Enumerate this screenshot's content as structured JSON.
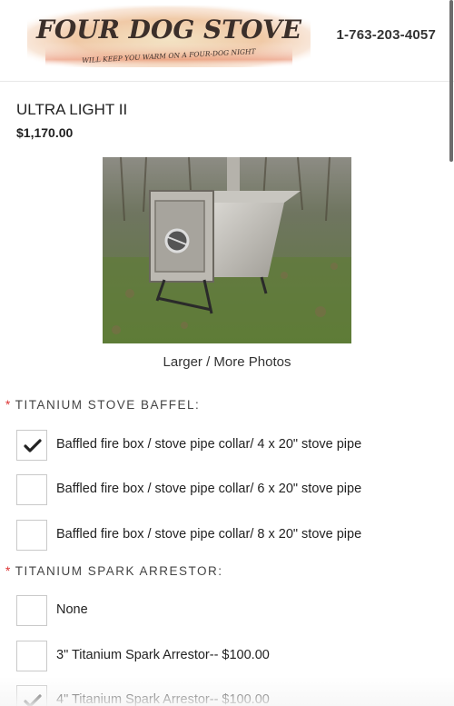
{
  "header": {
    "logo_text": "FOUR DOG STOVE",
    "logo_tagline": "WILL KEEP YOU WARM ON A FOUR-DOG NIGHT",
    "phone": "1-763-203-4057"
  },
  "product": {
    "name": "ULTRA LIGHT II",
    "price": "$1,170.00",
    "photo_link": "Larger / More Photos"
  },
  "colors": {
    "required": "#d33333",
    "check": "#222222",
    "border": "#c9c9c9"
  },
  "sections": [
    {
      "label": "TITANIUM STOVE BAFFEL:",
      "required_mark": "*",
      "options": [
        {
          "label": "Baffled fire box / stove pipe collar/ 4 x 20\" stove pipe",
          "checked": true
        },
        {
          "label": "Baffled fire box / stove pipe collar/ 6 x 20\" stove pipe",
          "checked": false
        },
        {
          "label": "Baffled fire box / stove pipe collar/ 8 x 20\" stove pipe",
          "checked": false
        }
      ]
    },
    {
      "label": "TITANIUM SPARK ARRESTOR:",
      "required_mark": "*",
      "options": [
        {
          "label": "None",
          "checked": false
        },
        {
          "label": "3\" Titanium Spark Arrestor-- $100.00",
          "checked": false
        },
        {
          "label": "4\" Titanium Spark Arrestor-- $100.00",
          "checked": true
        }
      ]
    }
  ]
}
